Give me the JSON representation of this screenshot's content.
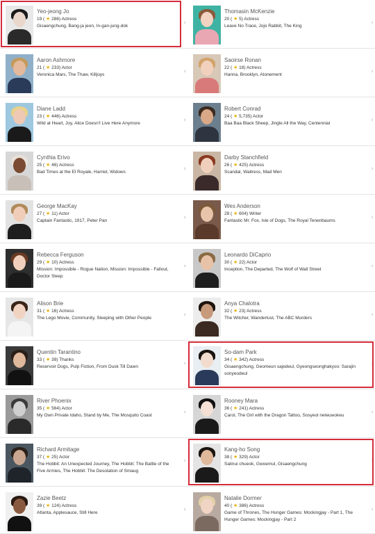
{
  "accent": "#d52b3a",
  "star_color": "#e5b000",
  "chevron_icon": "chevron-right-icon",
  "star_icon": "star-icon",
  "people": [
    {
      "name": "Yeo-jeong Jo",
      "rank": "19",
      "delta": "286",
      "role": "Actress",
      "works": "Gisaengchung, Bang-ja jeon, In-gan-jung-dok",
      "highlighted": true,
      "photo": {
        "bg": "#e8e8e8",
        "skin": "#e9d7cc",
        "hair": "#1a1a1a",
        "cloth": "#2a2a2a"
      }
    },
    {
      "name": "Thomasin McKenzie",
      "rank": "20",
      "delta": "5",
      "role": "Actress",
      "works": "Leave No Trace, Jojo Rabbit, The King",
      "highlighted": false,
      "photo": {
        "bg": "#3fb3a3",
        "skin": "#f2d2c0",
        "hair": "#8a5a3a",
        "cloth": "#e9a6b3"
      }
    },
    {
      "name": "Aaron Ashmore",
      "rank": "21",
      "delta": "233",
      "role": "Actor",
      "works": "Veronica Mars, The Thaw, Killjoys",
      "highlighted": false,
      "photo": {
        "bg": "#8fb0c8",
        "skin": "#e4b99c",
        "hair": "#c49a5c",
        "cloth": "#2a3b5a"
      }
    },
    {
      "name": "Saoirse Ronan",
      "rank": "22",
      "delta": "18",
      "role": "Actress",
      "works": "Hanna, Brooklyn, Atonement",
      "highlighted": false,
      "photo": {
        "bg": "#d8c8b8",
        "skin": "#f1d1bd",
        "hair": "#d2a36a",
        "cloth": "#d97a7a"
      }
    },
    {
      "name": "Diane Ladd",
      "rank": "23",
      "delta": "446",
      "role": "Actress",
      "works": "Wild at Heart, Joy, Alice Doesn't Live Here Anymore",
      "highlighted": false,
      "photo": {
        "bg": "#9ec7e0",
        "skin": "#efc9b4",
        "hair": "#e8d28a",
        "cloth": "#1a1a1a"
      }
    },
    {
      "name": "Robert Conrad",
      "rank": "24",
      "delta": "5,735",
      "role": "Actor",
      "works": "Baa Baa Black Sheep, Jingle All the Way, Centennial",
      "highlighted": false,
      "photo": {
        "bg": "#6b7f8e",
        "skin": "#d9a887",
        "hair": "#3b2a1e",
        "cloth": "#2e3540"
      }
    },
    {
      "name": "Cynthia Erivo",
      "rank": "25",
      "delta": "46",
      "role": "Actress",
      "works": "Bad Times at the El Royale, Harriet, Widows",
      "highlighted": false,
      "photo": {
        "bg": "#d7d7d7",
        "skin": "#7a4a32",
        "hair": "#e8e0d8",
        "cloth": "#c8c0b8"
      }
    },
    {
      "name": "Darby Stanchfield",
      "rank": "26",
      "delta": "425",
      "role": "Actress",
      "works": "Scandal, Waitress, Mad Men",
      "highlighted": false,
      "photo": {
        "bg": "#c9b6a4",
        "skin": "#f0d0bc",
        "hair": "#8a3a22",
        "cloth": "#3a2a2a"
      }
    },
    {
      "name": "George MacKay",
      "rank": "27",
      "delta": "11",
      "role": "Actor",
      "works": "Captain Fantastic, 1917, Peter Pan",
      "highlighted": false,
      "photo": {
        "bg": "#e2e2e2",
        "skin": "#efcdb8",
        "hair": "#b08a5a",
        "cloth": "#1e1e1e"
      }
    },
    {
      "name": "Wes Anderson",
      "rank": "28",
      "delta": "604",
      "role": "Writer",
      "works": "Fantastic Mr. Fox, Isle of Dogs, The Royal Tenenbaums",
      "highlighted": false,
      "photo": {
        "bg": "#7a5a4a",
        "skin": "#e8c4aa",
        "hair": "#7a5a38",
        "cloth": "#5a3a2a"
      }
    },
    {
      "name": "Rebecca Ferguson",
      "rank": "29",
      "delta": "10",
      "role": "Actress",
      "works": "Mission: Impossible - Rogue Nation, Mission: Impossible - Fallout, Doctor Sleep",
      "highlighted": false,
      "photo": {
        "bg": "#2e2e2e",
        "skin": "#f0d0bc",
        "hair": "#6a3a22",
        "cloth": "#1a1a1a"
      }
    },
    {
      "name": "Leonardo DiCaprio",
      "rank": "30",
      "delta": "22",
      "role": "Actor",
      "works": "Inception, The Departed, The Wolf of Wall Street",
      "highlighted": false,
      "photo": {
        "bg": "#c8c8c8",
        "skin": "#e7c2a6",
        "hair": "#8a6a44",
        "cloth": "#1e1e1e"
      }
    },
    {
      "name": "Alison Brie",
      "rank": "31",
      "delta": "16",
      "role": "Actress",
      "works": "The Lego Movie, Community, Sleeping with Other People",
      "highlighted": false,
      "photo": {
        "bg": "#e6e6e6",
        "skin": "#f1d3c2",
        "hair": "#3a2418",
        "cloth": "#f4f4f4"
      }
    },
    {
      "name": "Anya Chalotra",
      "rank": "32",
      "delta": "23",
      "role": "Actress",
      "works": "The Witcher, Wanderlust, The ABC Murders",
      "highlighted": false,
      "photo": {
        "bg": "#ececec",
        "skin": "#c79a7c",
        "hair": "#1e140e",
        "cloth": "#3a2a22"
      }
    },
    {
      "name": "Quentin Tarantino",
      "rank": "33",
      "delta": "39",
      "role": "Thanks",
      "works": "Reservoir Dogs, Pulp Fiction, From Dusk Till Dawn",
      "highlighted": false,
      "photo": {
        "bg": "#3a3a3a",
        "skin": "#e0b89c",
        "hair": "#2a1e16",
        "cloth": "#111111"
      }
    },
    {
      "name": "So-dam Park",
      "rank": "34",
      "delta": "342",
      "role": "Actress",
      "works": "Gisaengchung, Geomeun sajedeul, Gyeongseonghakyoo: Sarajin sonyeodeul",
      "highlighted": true,
      "photo": {
        "bg": "#e8eef2",
        "skin": "#f3dccd",
        "hair": "#1a1410",
        "cloth": "#2a3a5a"
      }
    },
    {
      "name": "River Phoenix",
      "rank": "35",
      "delta": "564",
      "role": "Actor",
      "works": "My Own Private Idaho, Stand by Me, The Mosquito Coast",
      "highlighted": false,
      "photo": {
        "bg": "#9a9a9a",
        "skin": "#cfcfcf",
        "hair": "#3a3a3a",
        "cloth": "#2a2a2a"
      }
    },
    {
      "name": "Rooney Mara",
      "rank": "36",
      "delta": "241",
      "role": "Actress",
      "works": "Carol, The Girl with the Dragon Tattoo, Sosyeol neteuwokeu",
      "highlighted": false,
      "photo": {
        "bg": "#d6d6d6",
        "skin": "#f4e0d4",
        "hair": "#111111",
        "cloth": "#1a1a1a"
      }
    },
    {
      "name": "Richard Armitage",
      "rank": "37",
      "delta": "25",
      "role": "Actor",
      "works": "The Hobbit: An Unexpected Journey, The Hobbit: The Battle of the Five Armies, The Hobbit: The Desolation of Smaug",
      "highlighted": false,
      "photo": {
        "bg": "#4a5660",
        "skin": "#c8a690",
        "hair": "#2a2018",
        "cloth": "#1e242a"
      }
    },
    {
      "name": "Kang-ho Song",
      "rank": "38",
      "delta": "329",
      "role": "Actor",
      "works": "Salinui chueok, Gwoemul, Gisaengchung",
      "highlighted": true,
      "photo": {
        "bg": "#e4e4e4",
        "skin": "#e0b89a",
        "hair": "#1a1410",
        "cloth": "#1a1a1a"
      }
    },
    {
      "name": "Zazie Beetz",
      "rank": "39",
      "delta": "124",
      "role": "Actress",
      "works": "Atlanta, Applesauce, Still Here",
      "highlighted": false,
      "photo": {
        "bg": "#f0f0f0",
        "skin": "#8a5a40",
        "hair": "#2a1a12",
        "cloth": "#111111"
      }
    },
    {
      "name": "Natalie Dormer",
      "rank": "40",
      "delta": "386",
      "role": "Actress",
      "works": "Game of Thrones, The Hunger Games: Mockingjay - Part 1, The Hunger Games: Mockingjay - Part 2",
      "highlighted": false,
      "photo": {
        "bg": "#b8aaa0",
        "skin": "#f0d4c4",
        "hair": "#e4d0a8",
        "cloth": "#7a6a60"
      }
    }
  ]
}
